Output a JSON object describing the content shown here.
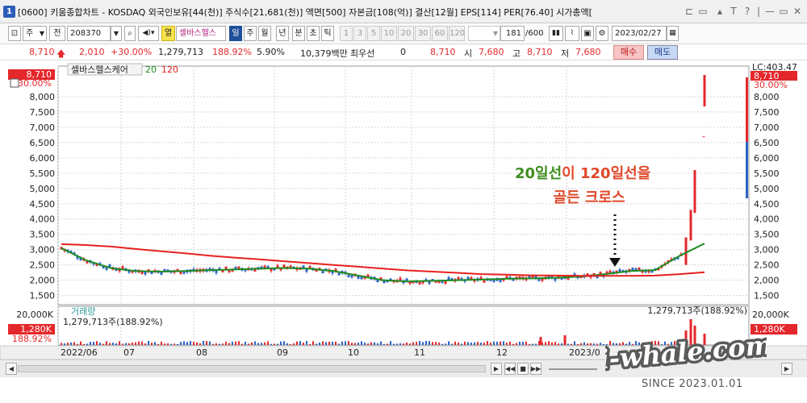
{
  "title": {
    "badge": "1",
    "text": "[0600] 키움종합차트 - KOSDAQ 외국인보유[44(천)] 주식수[21,681(천)] 액면[500] 자본금[108(억)] 결산[12월] EPS[114] PER[76.40] 시가총액["
  },
  "titlebar_buttons": [
    "⊏",
    "▭",
    "▴",
    "T",
    "?",
    "|",
    "—",
    "▭",
    "✕"
  ],
  "toolbar": {
    "period_select": "주",
    "all_select": "전",
    "code": "208370",
    "col_label": "열",
    "stock_name": "셀바스헬스",
    "period_tabs": [
      "일",
      "주",
      "월",
      "년",
      "분",
      "초",
      "틱"
    ],
    "intervals": [
      "1",
      "3",
      "5",
      "10",
      "20",
      "30",
      "60",
      "120"
    ],
    "count": "181",
    "count_total": "/600",
    "date": "2023/02/27"
  },
  "infobar": {
    "price": "8,710",
    "change": "2,010",
    "change_pct": "+30.00%",
    "volume": "1,279,713",
    "volume_ratio": "188.92%",
    "turnover": "5.90%",
    "amount": "10,379백만",
    "priority_label": "최우선",
    "priority_value": "0",
    "last": "8,710",
    "open_label": "시",
    "open": "7,680",
    "high_label": "고",
    "high": "8,710",
    "low_label": "저",
    "low": "7,680",
    "buy_button": "매수",
    "sell_button": "매도"
  },
  "chart_panel": {
    "stock_label": "셀바스헬스케어",
    "ma20_label": "20",
    "ma120_label": "120",
    "price_tag_left": "8,710",
    "pct_tag_left": "30.00%",
    "price_tag_right": "8,710",
    "pct_tag_right": "30.00%",
    "lc_label": "LC:403.47",
    "annotation_line1_a": "20일선",
    "annotation_line1_b": "이 120일선을",
    "annotation_line2": "골든 크로스",
    "volume_title": "거래량",
    "volume_value": "1,279,713주(188.92%)",
    "volume_value_right": "1,279,713주(188.92%)",
    "volume_axis_top": "20,000K",
    "volume_axis_top_right": "20,000K",
    "volume_tag_left": "1,280K",
    "volume_pct_left": "188.92%",
    "volume_tag_right": "1,280K",
    "y_ticks": [
      "8,000",
      "7,500",
      "7,000",
      "6,500",
      "6,000",
      "5,500",
      "5,000",
      "4,500",
      "4,000",
      "3,500",
      "3,000",
      "2,500",
      "2,000",
      "1,500"
    ],
    "x_ticks": [
      "2022/06",
      "07",
      "08",
      "09",
      "10",
      "11",
      "12",
      "2023/0"
    ]
  },
  "colors": {
    "up": "#e4272b",
    "down": "#2a62c9",
    "ma20": "#1e8c1e",
    "ma120": "#e82020",
    "annotation_green": "#3f8e1f",
    "annotation_red": "#e0482a"
  },
  "watermark": {
    "text": "i-whale.com",
    "since": "SINCE 2023.01.01"
  },
  "chart_data": {
    "type": "line",
    "title": "셀바스헬스케어",
    "ylim": [
      1200,
      9000
    ],
    "x_labels": [
      "2022/06",
      "07",
      "08",
      "09",
      "10",
      "11",
      "12",
      "2023/0"
    ],
    "series": [
      {
        "name": "20",
        "values": [
          3050,
          2650,
          2400,
          2300,
          2280,
          2300,
          2330,
          2350,
          2380,
          2400,
          2380,
          2300,
          2150,
          2000,
          1960,
          1980,
          2000,
          2020,
          2050,
          2060,
          2080,
          2120,
          2200,
          2300,
          2330,
          2800,
          3200
        ]
      },
      {
        "name": "120",
        "values": [
          3180,
          3150,
          3100,
          3020,
          2950,
          2880,
          2800,
          2740,
          2680,
          2620,
          2560,
          2500,
          2440,
          2380,
          2320,
          2280,
          2240,
          2200,
          2180,
          2160,
          2150,
          2140,
          2140,
          2140,
          2150,
          2200,
          2260
        ]
      }
    ],
    "last_price": 8710,
    "last_volume": 1279713
  }
}
